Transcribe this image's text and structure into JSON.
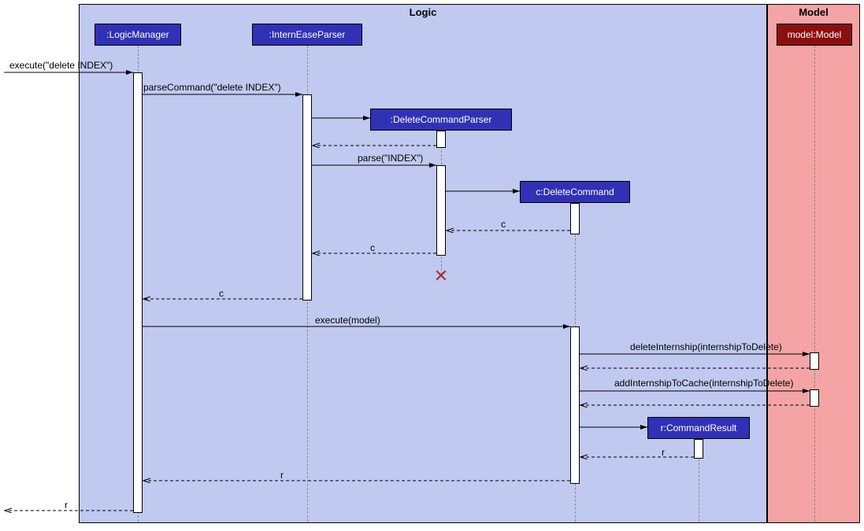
{
  "regions": {
    "logic": "Logic",
    "model": "Model"
  },
  "lifelines": {
    "logicManager": ":LogicManager",
    "internEaseParser": ":InternEaseParser",
    "deleteCommandParser": ":DeleteCommandParser",
    "deleteCommand": "c:DeleteCommand",
    "commandResult": "r:CommandResult",
    "model": "model:Model"
  },
  "messages": {
    "executeDelete": "execute(\"delete INDEX\")",
    "parseCommand": "parseCommand(\"delete INDEX\")",
    "parseIndex": "parse(\"INDEX\")",
    "returnC1": "c",
    "returnC2": "c",
    "returnC3": "c",
    "executeModel": "execute(model)",
    "deleteInternship": "deleteInternship(internshipToDelete)",
    "addInternshipToCache": "addInternshipToCache(internshipToDelete)",
    "returnR1": "r",
    "returnR2": "r",
    "returnR3": "r"
  }
}
